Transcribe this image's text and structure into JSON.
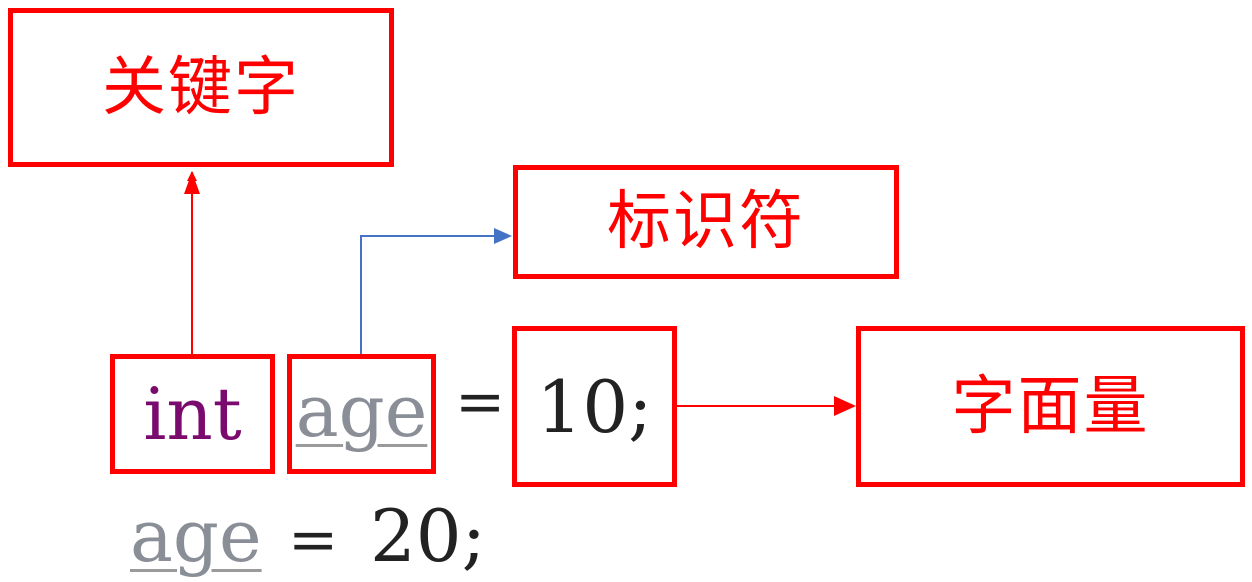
{
  "labels": {
    "keyword": "关键字",
    "identifier": "标识符",
    "literal": "字面量"
  },
  "code": {
    "line1": {
      "keyword": "int",
      "identifier": "age",
      "equals": "=",
      "literal": "10",
      "semicolon": ";"
    },
    "line2": {
      "identifier": "age",
      "equals": "=",
      "literal": "20",
      "semicolon": ";"
    }
  },
  "colors": {
    "box_border": "#ff0000",
    "label_text": "#ff0000",
    "keyword_text": "#7a0a6e",
    "identifier_text": "#8a8e96",
    "literal_text": "#222222",
    "arrow_red": "#ff0000",
    "arrow_blue": "#4472c4"
  },
  "arrows": [
    {
      "from": "keyword-box-int",
      "to": "label-box-keyword",
      "color": "red"
    },
    {
      "from": "identifier-box-age",
      "to": "label-box-identifier",
      "color": "blue"
    },
    {
      "from": "literal-box-10",
      "to": "label-box-literal",
      "color": "red"
    }
  ]
}
